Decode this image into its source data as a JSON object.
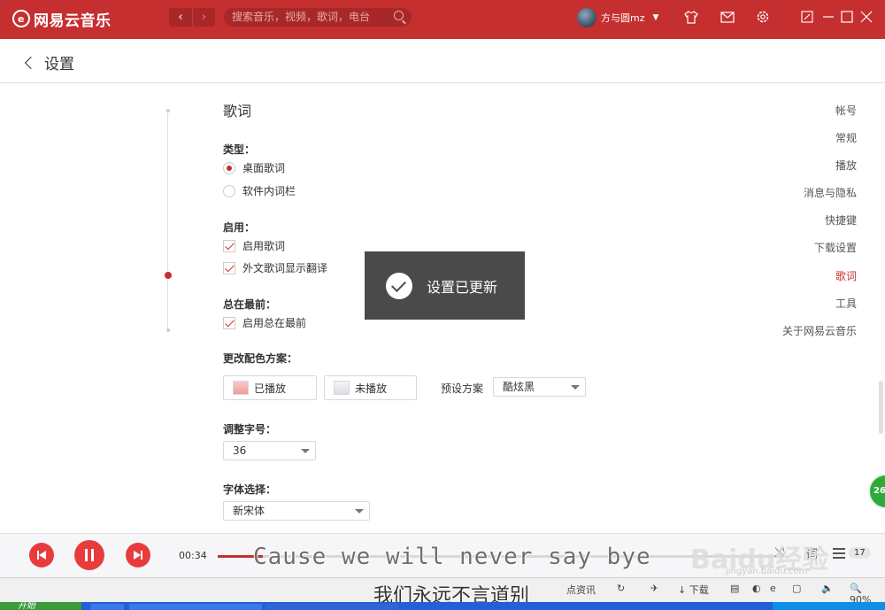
{
  "titlebar": {
    "app_name": "网易云音乐",
    "search_placeholder": "搜索音乐，视频，歌词，电台",
    "user_name": "方与圆mz",
    "accent": "#c62f2f"
  },
  "header": {
    "back_label": "设置"
  },
  "settings_nav": {
    "items": [
      "帐号",
      "常规",
      "播放",
      "消息与隐私",
      "快捷键",
      "下载设置",
      "歌词",
      "工具",
      "关于网易云音乐"
    ],
    "active": "歌词"
  },
  "lyrics": {
    "section_title": "歌词",
    "type_label": "类型：",
    "type_options": [
      "桌面歌词",
      "软件内词栏"
    ],
    "enable_label": "启用：",
    "enable_options": [
      "启用歌词",
      "外文歌词显示翻译"
    ],
    "ontop_label": "总在最前：",
    "ontop_option": "启用总在最前",
    "color_label": "更改配色方案：",
    "played_btn": "已播放",
    "unplayed_btn": "未播放",
    "preset_label": "预设方案",
    "preset_value": "酷炫黑",
    "fontsize_label": "调整字号：",
    "fontsize_value": "36",
    "font_label": "字体选择：",
    "font_value": "新宋体"
  },
  "toast": {
    "text": "设置已更新"
  },
  "float_badge": "26",
  "player": {
    "elapsed": "00:34",
    "progress": 0.08,
    "lyric_line1": "Cause we will never say bye",
    "lyric_line2": "我们永远不言道别",
    "playlist_count": "17"
  },
  "statusbar": {
    "items": [
      "点资讯",
      "下载"
    ],
    "zoom": "90%"
  },
  "taskbar": {
    "start_label": "开始"
  },
  "watermark": {
    "text": "Baidu经验",
    "url": "jingyan.baidu.com"
  }
}
